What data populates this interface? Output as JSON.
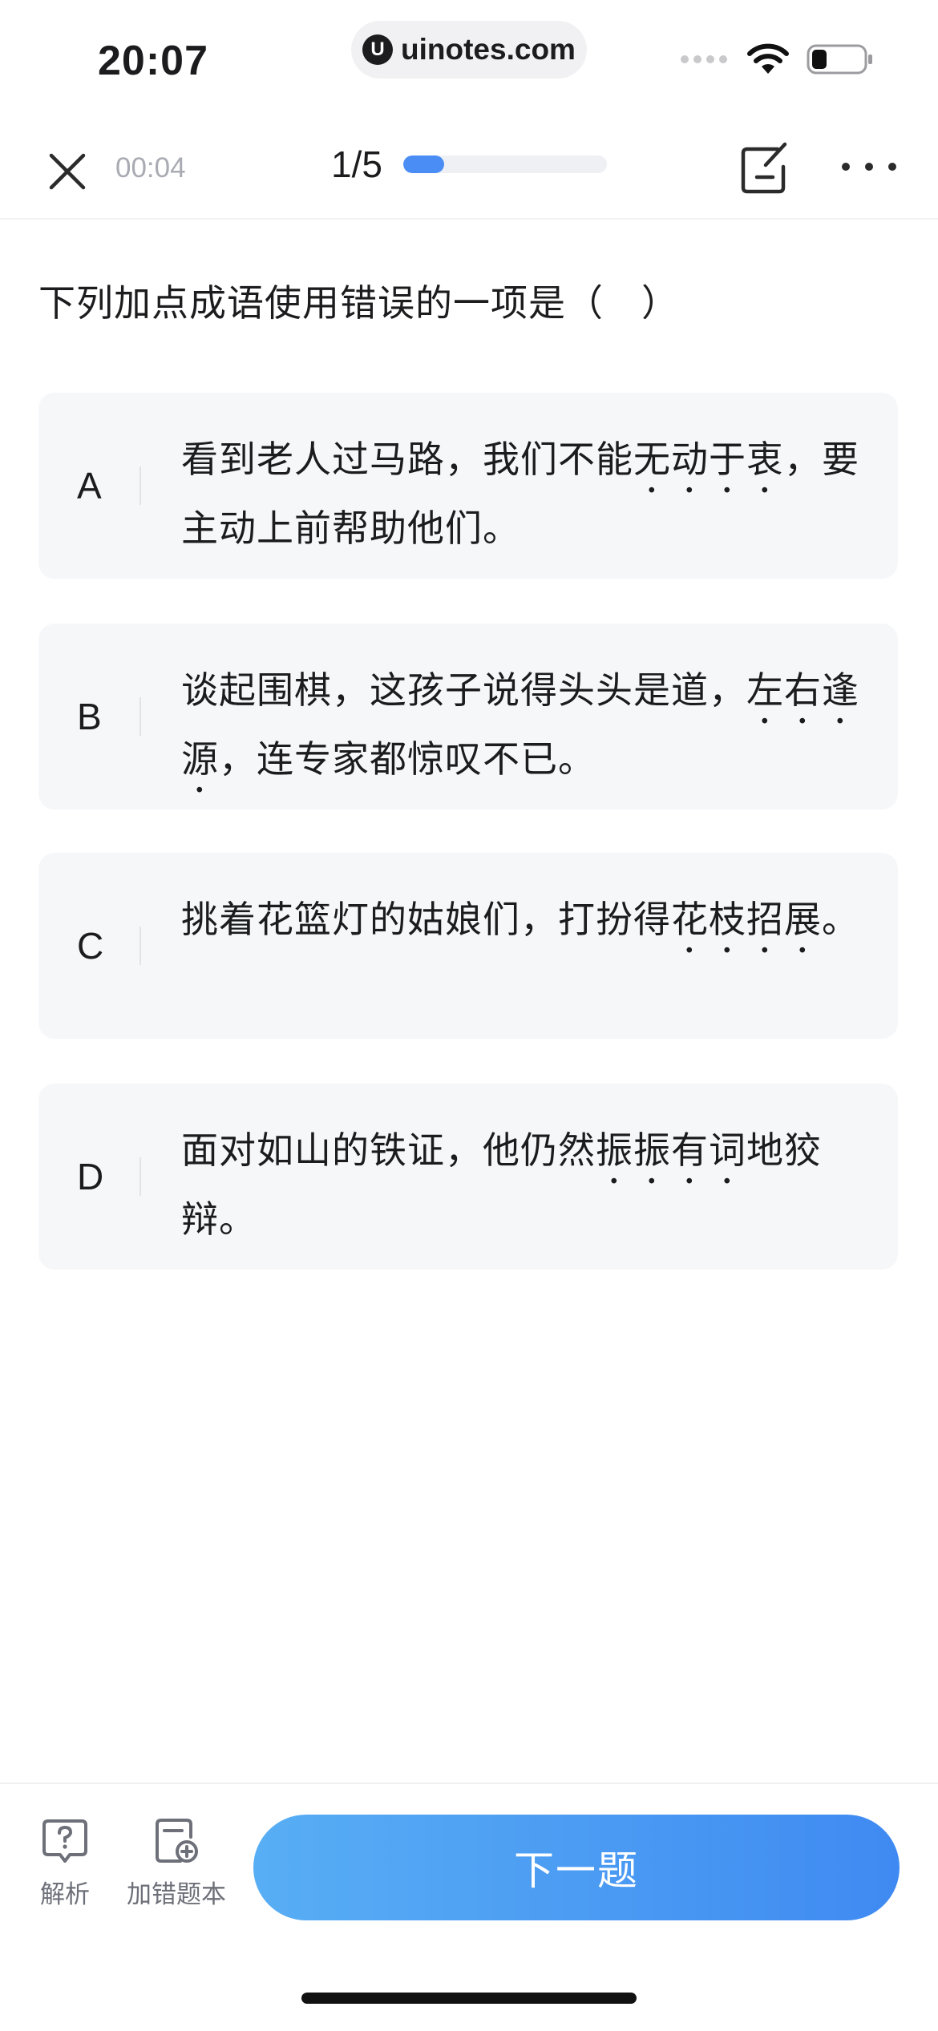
{
  "status_bar": {
    "time": "20:07",
    "url": "uinotes.com"
  },
  "nav": {
    "timer": "00:04",
    "progress_text": "1/5",
    "progress": 0.2
  },
  "question": {
    "text": "下列加点成语使用错误的一项是（　）"
  },
  "options": [
    {
      "letter": "A",
      "pre": "看到老人过马路，我们不能",
      "emph": "无动于衷",
      "post": "，要主动上前帮助他们。"
    },
    {
      "letter": "B",
      "pre": "谈起围棋，这孩子说得头头是道，",
      "emph": "左右逢源",
      "post": "，连专家都惊叹不已。"
    },
    {
      "letter": "C",
      "pre": "挑着花篮灯的姑娘们，打扮得",
      "emph": "花枝招展",
      "post": "。"
    },
    {
      "letter": "D",
      "pre": "面对如山的铁证，他仍然",
      "emph": "振振有词",
      "post": "地狡辩。"
    }
  ],
  "bottom": {
    "analysis_label": "解析",
    "add_wrong_label": "加错题本",
    "next_label": "下一题"
  },
  "colors": {
    "accent": "#4a8ef5",
    "button_start": "#58aef4",
    "button_end": "#3f8af2",
    "card_bg": "#f6f7f9"
  }
}
